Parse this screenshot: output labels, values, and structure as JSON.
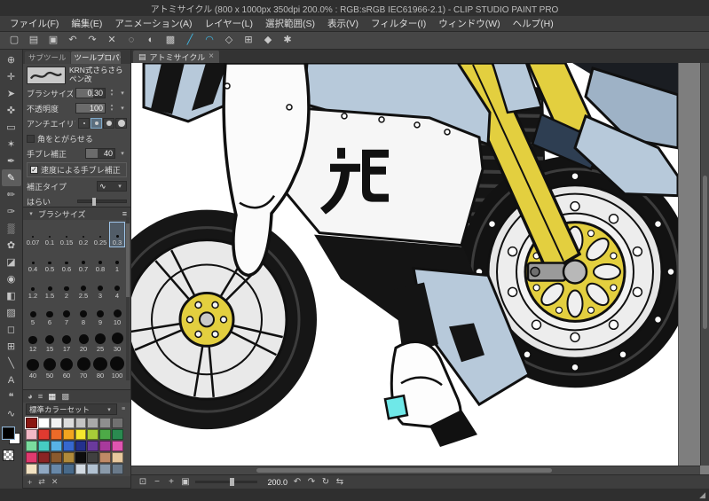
{
  "ui": {
    "dropdown": "▾",
    "spin_up": "▴",
    "spin_down": "▾",
    "menu_icon": "≡",
    "close": "×",
    "check": "✓",
    "page_icon": "▤",
    "grip": "◢",
    "expander": "▸",
    "squiggle": "∿"
  },
  "colors": {
    "accent_cyan": "#3fb9e6",
    "selection_blue": "#9fc4e8",
    "body_blue": "#b7c9da",
    "fork_yellow": "#e3cf3f",
    "boot_cyan": "#6fe8e8",
    "main_color": "#000000",
    "sub_color": "#ffffff"
  },
  "title_bar": {
    "title": "アトミサイクル (800 x 1000px 350dpi 200.0% : RGB:sRGB IEC61966-2.1) - CLIP STUDIO PAINT PRO"
  },
  "menu": {
    "items": [
      "ファイル(F)",
      "編集(E)",
      "アニメーション(A)",
      "レイヤー(L)",
      "選択範囲(S)",
      "表示(V)",
      "フィルター(I)",
      "ウィンドウ(W)",
      "ヘルプ(H)"
    ]
  },
  "toolbar": {
    "buttons": [
      {
        "name": "new-canvas-icon",
        "glyph": "▢"
      },
      {
        "name": "open-file-icon",
        "glyph": "▤"
      },
      {
        "name": "save-icon",
        "glyph": "▣"
      },
      {
        "name": "undo-icon",
        "glyph": "↶"
      },
      {
        "name": "redo-icon",
        "glyph": "↷"
      },
      {
        "name": "delete-icon",
        "glyph": "✕"
      },
      {
        "name": "deselect-icon",
        "glyph": "◌"
      },
      {
        "name": "invert-selection-icon",
        "glyph": "◐"
      },
      {
        "name": "selection-border-icon",
        "glyph": "▩"
      },
      {
        "name": "snap-ruler-icon",
        "glyph": "╱",
        "accent": true
      },
      {
        "name": "snap-special-ruler-icon",
        "glyph": "◠",
        "accent": true
      },
      {
        "name": "snap-guide-icon",
        "glyph": "◇"
      },
      {
        "name": "grid-icon",
        "glyph": "⊞"
      },
      {
        "name": "material-icon",
        "glyph": "◆"
      },
      {
        "name": "settings-icon",
        "glyph": "✱"
      }
    ]
  },
  "tool_strip": {
    "tools": [
      {
        "name": "zoom-tool-icon",
        "glyph": "⊕"
      },
      {
        "name": "move-tool-icon",
        "glyph": "✛"
      },
      {
        "name": "operation-tool-icon",
        "glyph": "➤"
      },
      {
        "name": "layer-move-tool-icon",
        "glyph": "✜"
      },
      {
        "name": "selection-tool-icon",
        "glyph": "▭"
      },
      {
        "name": "auto-select-tool-icon",
        "glyph": "✶"
      },
      {
        "name": "eyedropper-tool-icon",
        "glyph": "✒"
      },
      {
        "name": "pen-tool-icon",
        "glyph": "✎",
        "selected": true
      },
      {
        "name": "pencil-tool-icon",
        "glyph": "✏"
      },
      {
        "name": "brush-tool-icon",
        "glyph": "✑"
      },
      {
        "name": "airbrush-tool-icon",
        "glyph": "▒"
      },
      {
        "name": "decoration-tool-icon",
        "glyph": "✿"
      },
      {
        "name": "eraser-tool-icon",
        "glyph": "◪"
      },
      {
        "name": "blend-tool-icon",
        "glyph": "◉"
      },
      {
        "name": "fill-tool-icon",
        "glyph": "◧"
      },
      {
        "name": "gradient-tool-icon",
        "glyph": "▨"
      },
      {
        "name": "figure-tool-icon",
        "glyph": "◻"
      },
      {
        "name": "frame-border-tool-icon",
        "glyph": "⊞"
      },
      {
        "name": "ruler-tool-icon",
        "glyph": "╲"
      },
      {
        "name": "text-tool-icon",
        "glyph": "A"
      },
      {
        "name": "balloon-tool-icon",
        "glyph": "❝"
      },
      {
        "name": "line-correct-tool-icon",
        "glyph": "∿"
      }
    ]
  },
  "tool_property": {
    "tabs": [
      "サブツール",
      "ツールプロパティ"
    ],
    "brush_name": "KRN式さらさらペン改",
    "brush_size_label": "ブラシサイズ",
    "brush_size_value": "0.30",
    "opacity_label": "不透明度",
    "opacity_value": "100",
    "antialias_label": "アンチエイリアス",
    "sharpen_label": "角をとがらせる",
    "stabilize_label": "手ブレ補正",
    "stabilize_value": "40",
    "speed_stabilize_label": "速度による手ブレ補正",
    "correction_type_label": "補正タイプ",
    "harai_label": "はらい",
    "footer_icons": [
      {
        "name": "register-settings-icon",
        "glyph": "▣"
      },
      {
        "name": "reset-settings-icon",
        "glyph": "↺"
      }
    ]
  },
  "brush_size_panel": {
    "title": "ブラシサイズ",
    "sizes": [
      {
        "label": "0.07",
        "d": "2px"
      },
      {
        "label": "0.1",
        "d": "2px"
      },
      {
        "label": "0.15",
        "d": "2px"
      },
      {
        "label": "0.2",
        "d": "2.5px"
      },
      {
        "label": "0.25",
        "d": "2.5px"
      },
      {
        "label": "0.3",
        "d": "3px",
        "selected": true
      },
      {
        "label": "0.4",
        "d": "3px"
      },
      {
        "label": "0.5",
        "d": "3.5px"
      },
      {
        "label": "0.6",
        "d": "3.5px"
      },
      {
        "label": "0.7",
        "d": "4px"
      },
      {
        "label": "0.8",
        "d": "4px"
      },
      {
        "label": "1",
        "d": "4.5px"
      },
      {
        "label": "1.2",
        "d": "4.5px"
      },
      {
        "label": "1.5",
        "d": "5px"
      },
      {
        "label": "2",
        "d": "5.5px"
      },
      {
        "label": "2.5",
        "d": "6px"
      },
      {
        "label": "3",
        "d": "6px"
      },
      {
        "label": "4",
        "d": "6.5px"
      },
      {
        "label": "5",
        "d": "7px"
      },
      {
        "label": "6",
        "d": "7.5px"
      },
      {
        "label": "7",
        "d": "8px"
      },
      {
        "label": "8",
        "d": "8px"
      },
      {
        "label": "9",
        "d": "8.5px"
      },
      {
        "label": "10",
        "d": "9px"
      },
      {
        "label": "12",
        "d": "9.5px"
      },
      {
        "label": "15",
        "d": "10px"
      },
      {
        "label": "17",
        "d": "10.5px"
      },
      {
        "label": "20",
        "d": "11px"
      },
      {
        "label": "25",
        "d": "12px"
      },
      {
        "label": "30",
        "d": "13px"
      },
      {
        "label": "40",
        "d": "13.5px"
      },
      {
        "label": "50",
        "d": "14px"
      },
      {
        "label": "60",
        "d": "14.5px"
      },
      {
        "label": "70",
        "d": "15px"
      },
      {
        "label": "80",
        "d": "15.5px"
      },
      {
        "label": "100",
        "d": "16px"
      }
    ]
  },
  "color_panel": {
    "tabs": [
      {
        "name": "color-wheel-icon",
        "glyph": "◕"
      },
      {
        "name": "color-sliders-icon",
        "glyph": "≡"
      },
      {
        "name": "color-set-icon",
        "glyph": "▦",
        "selected": true
      },
      {
        "name": "intermediate-color-icon",
        "glyph": "▩"
      }
    ],
    "set_name": "標準カラーセット",
    "swatches": [
      {
        "c": "#8a1712",
        "sel": true
      },
      {
        "c": "#ffffff"
      },
      {
        "c": "#f2f2f2"
      },
      {
        "c": "#dcdcdc"
      },
      {
        "c": "#c4c4c4"
      },
      {
        "c": "#a9a9a9"
      },
      {
        "c": "#8e8e8e"
      },
      {
        "c": "#707070"
      },
      {
        "c": "#f2b8c6"
      },
      {
        "c": "#e03a30"
      },
      {
        "c": "#ec6a28"
      },
      {
        "c": "#f2a51f"
      },
      {
        "c": "#f5e62e"
      },
      {
        "c": "#a8cc38"
      },
      {
        "c": "#4daa47"
      },
      {
        "c": "#2a8a50"
      },
      {
        "c": "#7adc9e"
      },
      {
        "c": "#46ccc2"
      },
      {
        "c": "#58b2e6"
      },
      {
        "c": "#3668cf"
      },
      {
        "c": "#23308c"
      },
      {
        "c": "#6a3a9c"
      },
      {
        "c": "#a83a9c"
      },
      {
        "c": "#e055b0"
      },
      {
        "c": "#e03a6e"
      },
      {
        "c": "#8a2424"
      },
      {
        "c": "#8a5a2e"
      },
      {
        "c": "#b08a3a"
      },
      {
        "c": "#0d0d0d"
      },
      {
        "c": "#404040"
      },
      {
        "c": "#c08a66"
      },
      {
        "c": "#e8c89e"
      },
      {
        "c": "#f2e2c2"
      },
      {
        "c": "#90a8c2"
      },
      {
        "c": "#6888a8"
      },
      {
        "c": "#486a8a"
      },
      {
        "c": "#d2dae2"
      },
      {
        "c": "#b2c2d2"
      },
      {
        "c": "#8a9aaa"
      },
      {
        "c": "#6a7a8a"
      }
    ],
    "footer": [
      {
        "name": "add-swatch-icon",
        "glyph": "+"
      },
      {
        "name": "replace-swatch-icon",
        "glyph": "⇄"
      },
      {
        "name": "delete-swatch-icon",
        "glyph": "✕"
      }
    ]
  },
  "canvas": {
    "tab_label": "アトミサイクル"
  },
  "bottom_bar": {
    "left_buttons": [
      {
        "name": "fit-screen-icon",
        "glyph": "⊡"
      },
      {
        "name": "zoom-out-icon",
        "glyph": "−"
      },
      {
        "name": "zoom-in-icon",
        "glyph": "+"
      },
      {
        "name": "actual-size-icon",
        "glyph": "▣"
      }
    ],
    "zoom_value": "200.0",
    "right_buttons": [
      {
        "name": "rotate-ccw-icon",
        "glyph": "↶"
      },
      {
        "name": "rotate-cw-icon",
        "glyph": "↷"
      },
      {
        "name": "reset-rotation-icon",
        "glyph": "↻"
      },
      {
        "name": "flip-horizontal-icon",
        "glyph": "⇆"
      }
    ]
  },
  "status_bar": {
    "icons": [
      {
        "name": "resize-grip-icon",
        "glyph": "◢"
      }
    ]
  }
}
